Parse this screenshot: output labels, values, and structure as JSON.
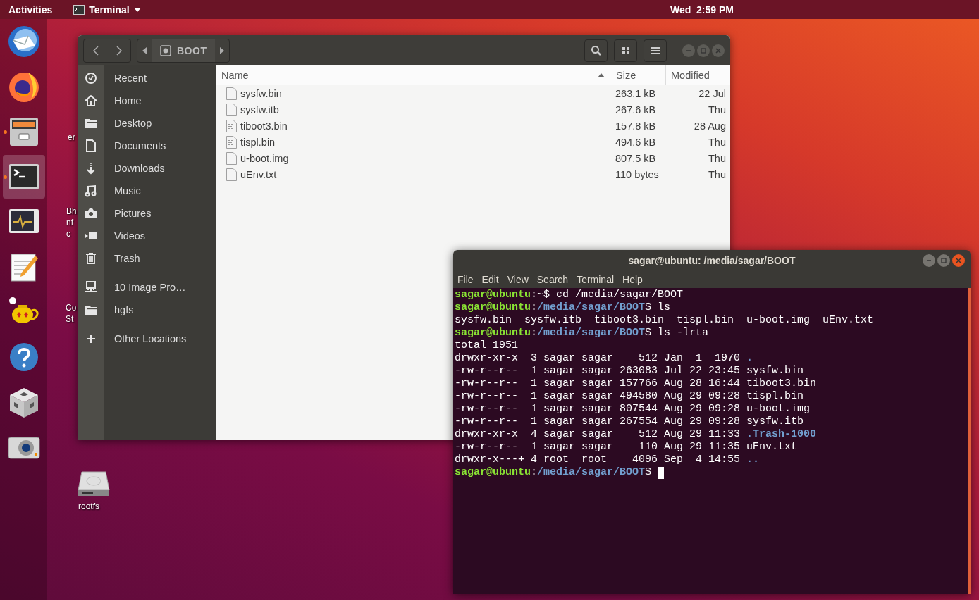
{
  "top_bar": {
    "activities": "Activities",
    "app_menu": "Terminal",
    "clock": "Wed  2:59 PM"
  },
  "dock": {
    "items": [
      {
        "kind": "mail",
        "running": false,
        "selected": false
      },
      {
        "kind": "browser",
        "running": false,
        "selected": false
      },
      {
        "kind": "files",
        "running": true,
        "selected": false
      },
      {
        "kind": "terminal",
        "running": true,
        "selected": true
      },
      {
        "kind": "monitor",
        "running": false,
        "selected": false
      },
      {
        "kind": "editor",
        "running": false,
        "selected": false
      },
      {
        "kind": "teapot",
        "running": false,
        "selected": false
      },
      {
        "kind": "help",
        "running": false,
        "selected": false
      },
      {
        "kind": "cube",
        "running": false,
        "selected": false
      },
      {
        "kind": "camera",
        "running": false,
        "selected": false
      }
    ]
  },
  "desktop": {
    "icons": [
      {
        "kind": "hidden",
        "lines": [
          "er"
        ]
      },
      {
        "kind": "hidden",
        "lines": [
          "Bh",
          "nf",
          "c"
        ]
      },
      {
        "kind": "hidden",
        "lines": [
          "Co",
          "St"
        ]
      },
      {
        "kind": "drive",
        "lines": [
          "rootfs"
        ]
      }
    ]
  },
  "file_manager": {
    "focused": false,
    "path_button": "BOOT",
    "sidebar": {
      "sections": [
        {
          "items": [
            {
              "kind": "recent",
              "label": "Recent"
            },
            {
              "kind": "home",
              "label": "Home"
            },
            {
              "kind": "folder",
              "label": "Desktop"
            },
            {
              "kind": "document",
              "label": "Documents"
            },
            {
              "kind": "download",
              "label": "Downloads"
            },
            {
              "kind": "music",
              "label": "Music"
            },
            {
              "kind": "camera",
              "label": "Pictures"
            },
            {
              "kind": "video",
              "label": "Videos"
            },
            {
              "kind": "trash",
              "label": "Trash"
            }
          ]
        },
        {
          "items": [
            {
              "kind": "network",
              "label": "10 Image Pro…"
            },
            {
              "kind": "folder",
              "label": "hgfs"
            }
          ]
        },
        {
          "items": [
            {
              "kind": "plus",
              "label": "Other Locations"
            }
          ]
        }
      ]
    },
    "columns": [
      {
        "label": "Name",
        "sorted": true
      },
      {
        "label": "Size",
        "sorted": false
      },
      {
        "label": "Modified",
        "sorted": false
      }
    ],
    "files": [
      {
        "kind": "binary",
        "name": "sysfw.bin",
        "size": "263.1 kB",
        "modified": "22 Jul"
      },
      {
        "kind": "text",
        "name": "sysfw.itb",
        "size": "267.6 kB",
        "modified": "Thu"
      },
      {
        "kind": "binary",
        "name": "tiboot3.bin",
        "size": "157.8 kB",
        "modified": "28 Aug"
      },
      {
        "kind": "binary",
        "name": "tispl.bin",
        "size": "494.6 kB",
        "modified": "Thu"
      },
      {
        "kind": "text",
        "name": "u-boot.img",
        "size": "807.5 kB",
        "modified": "Thu"
      },
      {
        "kind": "text",
        "name": "uEnv.txt",
        "size": "110 bytes",
        "modified": "Thu"
      }
    ]
  },
  "terminal": {
    "focused": true,
    "title": "sagar@ubuntu: /media/sagar/BOOT",
    "menu": [
      "File",
      "Edit",
      "View",
      "Search",
      "Terminal",
      "Help"
    ],
    "lines": [
      {
        "cursor": false,
        "segments": [
          {
            "kind": "user",
            "text": "sagar@ubuntu"
          },
          {
            "kind": "plain",
            "text": ":~$ cd /media/sagar/BOOT"
          }
        ]
      },
      {
        "cursor": false,
        "segments": [
          {
            "kind": "user",
            "text": "sagar@ubuntu"
          },
          {
            "kind": "plain",
            "text": ":"
          },
          {
            "kind": "path",
            "text": "/media/sagar/BOOT"
          },
          {
            "kind": "plain",
            "text": "$ ls"
          }
        ]
      },
      {
        "cursor": false,
        "segments": [
          {
            "kind": "plain",
            "text": "sysfw.bin  sysfw.itb  tiboot3.bin  tispl.bin  u-boot.img  uEnv.txt"
          }
        ]
      },
      {
        "cursor": false,
        "segments": [
          {
            "kind": "user",
            "text": "sagar@ubuntu"
          },
          {
            "kind": "plain",
            "text": ":"
          },
          {
            "kind": "path",
            "text": "/media/sagar/BOOT"
          },
          {
            "kind": "plain",
            "text": "$ ls -lrta"
          }
        ]
      },
      {
        "cursor": false,
        "segments": [
          {
            "kind": "plain",
            "text": "total 1951"
          }
        ]
      },
      {
        "cursor": false,
        "segments": [
          {
            "kind": "plain",
            "text": "drwxr-xr-x  3 sagar sagar    512 Jan  1  1970 "
          },
          {
            "kind": "dir",
            "text": "."
          }
        ]
      },
      {
        "cursor": false,
        "segments": [
          {
            "kind": "plain",
            "text": "-rw-r--r--  1 sagar sagar 263083 Jul 22 23:45 sysfw.bin"
          }
        ]
      },
      {
        "cursor": false,
        "segments": [
          {
            "kind": "plain",
            "text": "-rw-r--r--  1 sagar sagar 157766 Aug 28 16:44 tiboot3.bin"
          }
        ]
      },
      {
        "cursor": false,
        "segments": [
          {
            "kind": "plain",
            "text": "-rw-r--r--  1 sagar sagar 494580 Aug 29 09:28 tispl.bin"
          }
        ]
      },
      {
        "cursor": false,
        "segments": [
          {
            "kind": "plain",
            "text": "-rw-r--r--  1 sagar sagar 807544 Aug 29 09:28 u-boot.img"
          }
        ]
      },
      {
        "cursor": false,
        "segments": [
          {
            "kind": "plain",
            "text": "-rw-r--r--  1 sagar sagar 267554 Aug 29 09:28 sysfw.itb"
          }
        ]
      },
      {
        "cursor": false,
        "segments": [
          {
            "kind": "plain",
            "text": "drwxr-xr-x  4 sagar sagar    512 Aug 29 11:33 "
          },
          {
            "kind": "dir",
            "text": ".Trash-1000"
          }
        ]
      },
      {
        "cursor": false,
        "segments": [
          {
            "kind": "plain",
            "text": "-rw-r--r--  1 sagar sagar    110 Aug 29 11:35 uEnv.txt"
          }
        ]
      },
      {
        "cursor": false,
        "segments": [
          {
            "kind": "plain",
            "text": "drwxr-x---+ 4 root  root    4096 Sep  4 14:55 "
          },
          {
            "kind": "dir",
            "text": ".."
          }
        ]
      },
      {
        "cursor": true,
        "segments": [
          {
            "kind": "user",
            "text": "sagar@ubuntu"
          },
          {
            "kind": "plain",
            "text": ":"
          },
          {
            "kind": "path",
            "text": "/media/sagar/BOOT"
          },
          {
            "kind": "plain",
            "text": "$ "
          }
        ]
      }
    ]
  }
}
